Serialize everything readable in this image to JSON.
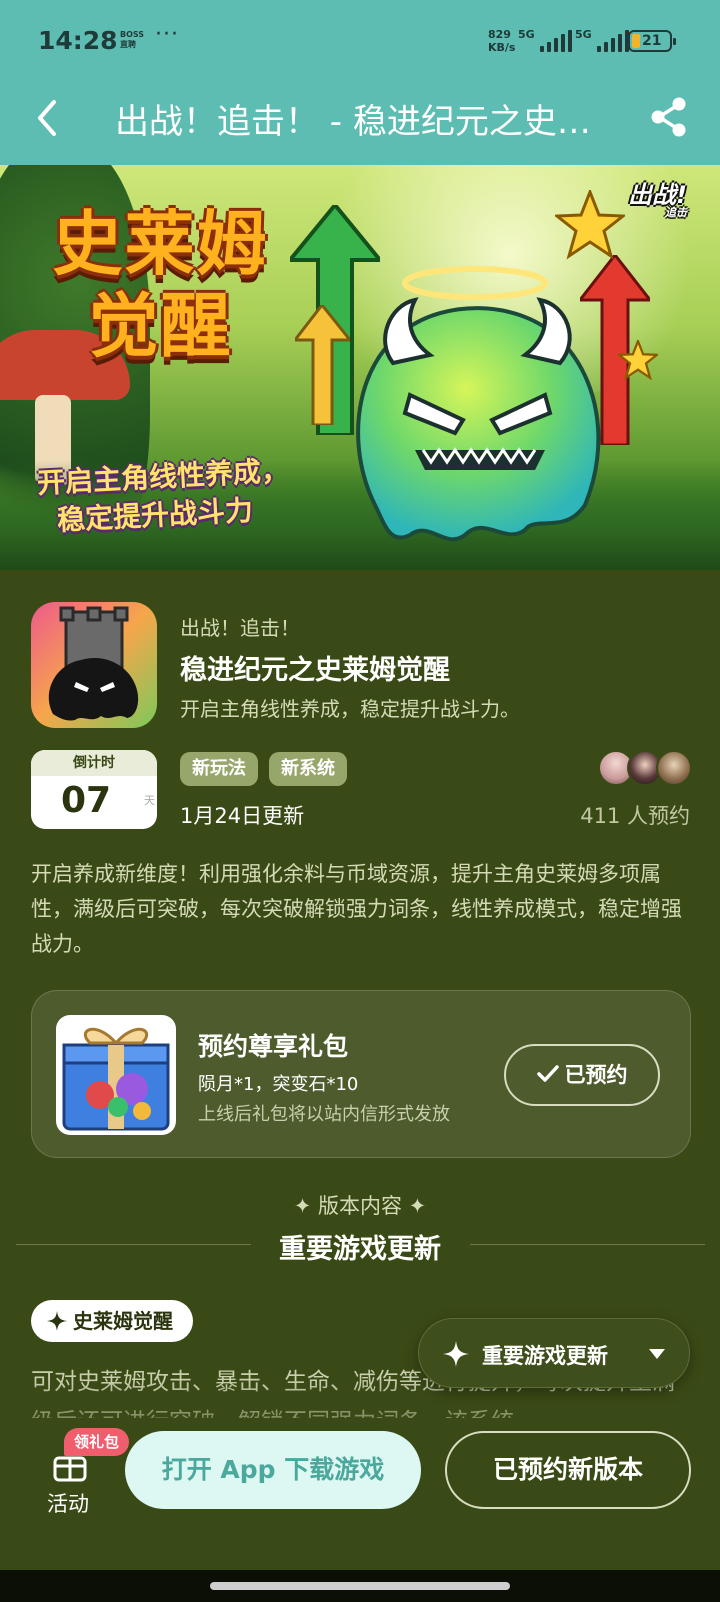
{
  "status_bar": {
    "time": "14:28",
    "app_badge_line1": "BOSS",
    "app_badge_line2": "直聘",
    "more": "···",
    "net_speed_value": "829",
    "net_speed_unit": "KB/s",
    "signal1_label": "5G",
    "signal2_label": "5G",
    "battery": "21",
    "battery_color": "#f4b42a"
  },
  "nav": {
    "title": "出战！追击！ - 稳进纪元之史莱姆觉醒",
    "back_icon": "chevron-left-icon",
    "share_icon": "share-icon"
  },
  "banner": {
    "title": "史莱姆觉醒",
    "subtitle_line1": "开启主角线性养成，",
    "subtitle_line2": "稳定提升战斗力",
    "logo_main": "出战!",
    "logo_small": "追击"
  },
  "app": {
    "pre_title": "出战！追击！",
    "name": "稳进纪元之史莱姆觉醒",
    "description": "开启主角线性养成，稳定提升战斗力。",
    "countdown_label": "倒计时",
    "countdown_value": "07",
    "countdown_unit": "天",
    "tags": [
      "新玩法",
      "新系统"
    ],
    "update_date": "1月24日更新",
    "reserve_count": "411 人预约"
  },
  "intro": "开启养成新维度！利用强化余料与币域资源，提升主角史莱姆多项属性，满级后可突破，每次突破解锁强力词条，线性养成模式，稳定增强战力。",
  "gift": {
    "title": "预约尊享礼包",
    "items": "陨月*1，突变石*10",
    "note": "上线后礼包将以站内信形式发放",
    "button_label": "已预约"
  },
  "section": {
    "kicker": "✦ 版本内容 ✦",
    "title": "重要游戏更新",
    "chip": "史莱姆觉醒",
    "body": "可对史莱姆攻击、暴击、生命、减伤等进行提升，每次提升至满级后还可进行突破，解锁不同强力词条，该系统",
    "float_label": "重要游戏更新"
  },
  "bottom_bar": {
    "activity_label": "活动",
    "redeem_badge": "领礼包",
    "open_app_label": "打开 App 下载游戏",
    "reserved_label": "已预约新版本"
  },
  "colors": {
    "accent_teal": "#5dbdb2",
    "page_bg": "#3a4a16",
    "badge_red": "#f05d6c"
  }
}
